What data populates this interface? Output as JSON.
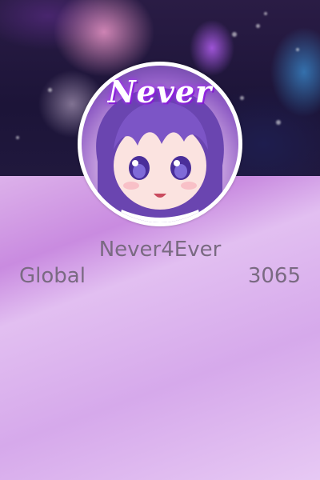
{
  "profile": {
    "avatar_text": "Never",
    "username": "Never4Ever"
  },
  "rank": {
    "label": "Global",
    "value": "3065"
  },
  "colors": {
    "text": "#7a6a82",
    "background_accent": "#d6a9eb",
    "avatar_ring": "#ffffff"
  }
}
